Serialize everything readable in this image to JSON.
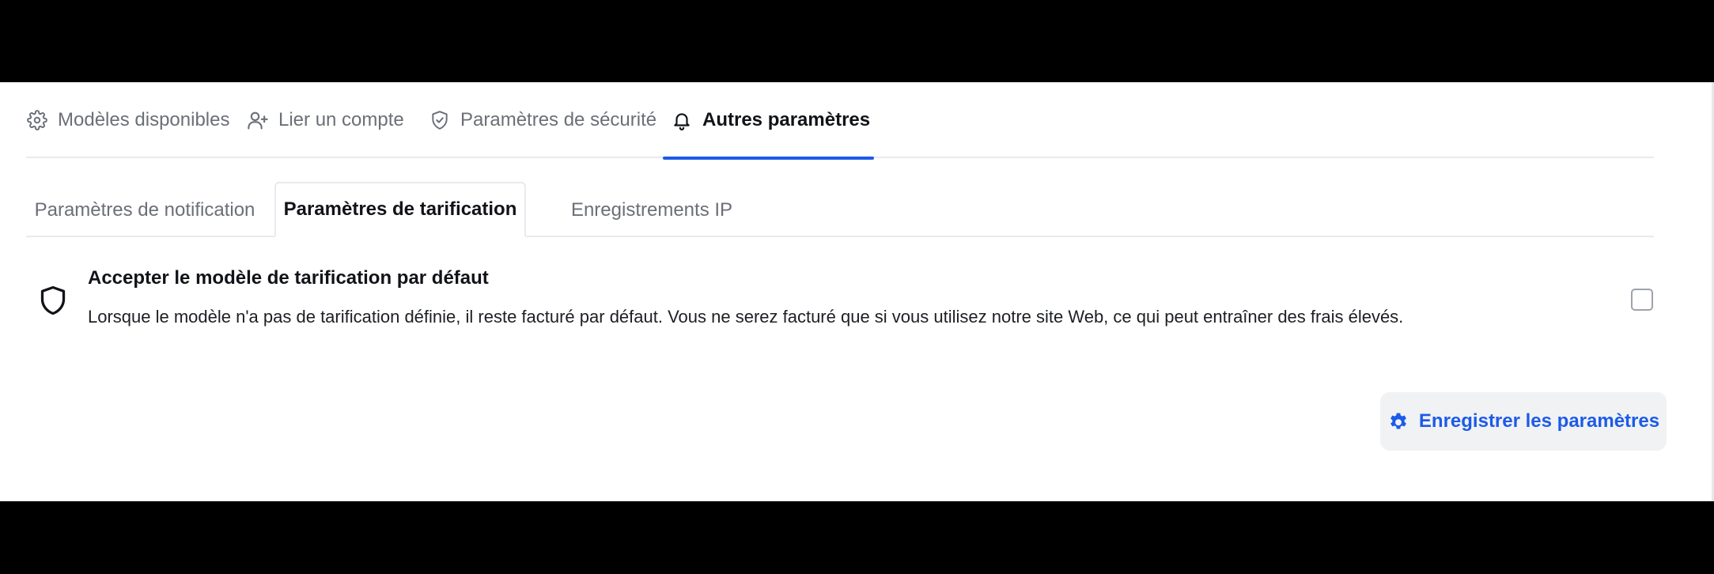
{
  "main_tabs": [
    {
      "label": "Modèles disponibles",
      "icon": "gear-icon",
      "active": false
    },
    {
      "label": "Lier un compte",
      "icon": "user-plus-icon",
      "active": false
    },
    {
      "label": "Paramètres de sécurité",
      "icon": "shield-check-icon",
      "active": false
    },
    {
      "label": "Autres paramètres",
      "icon": "bell-icon",
      "active": true
    }
  ],
  "sub_tabs": [
    {
      "label": "Paramètres de notification",
      "active": false
    },
    {
      "label": "Paramètres de tarification",
      "active": true
    },
    {
      "label": "Enregistrements IP",
      "active": false
    }
  ],
  "setting": {
    "icon": "shield-icon",
    "title": "Accepter le modèle de tarification par défaut",
    "description": "Lorsque le modèle n'a pas de tarification définie, il reste facturé par défaut. Vous ne serez facturé que si vous utilisez notre site Web, ce qui peut entraîner des frais élevés.",
    "checked": false
  },
  "save_button": {
    "label": "Enregistrer les paramètres",
    "icon": "gear-icon"
  },
  "colors": {
    "accent": "#1d5be8",
    "text_primary": "#111318",
    "text_muted": "#6b6f76",
    "border": "#e8eaee",
    "button_bg": "#f1f2f4"
  }
}
